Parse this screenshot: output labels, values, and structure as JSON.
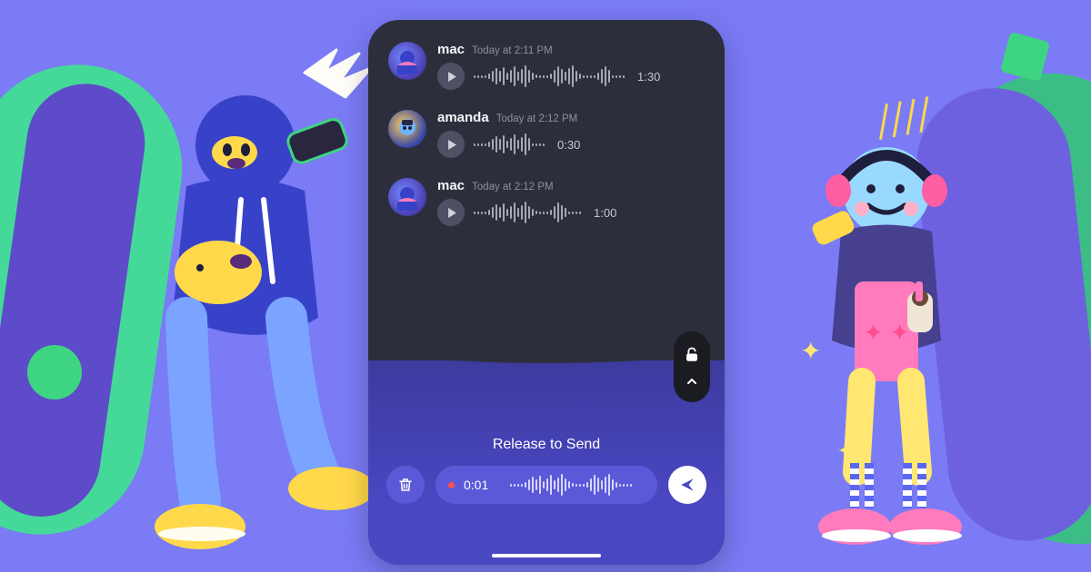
{
  "colors": {
    "bg": "#7a7bf5",
    "phone_bg": "#2c2f3b",
    "panel": "#4a47c2",
    "accent_green": "#3dd581",
    "accent_yellow": "#ffd94a"
  },
  "messages": [
    {
      "username": "mac",
      "avatar": "mac",
      "timestamp": "Today at 2:11 PM",
      "duration": "1:30",
      "wave_len": "long"
    },
    {
      "username": "amanda",
      "avatar": "amanda",
      "timestamp": "Today at 2:12 PM",
      "duration": "0:30",
      "wave_len": "short"
    },
    {
      "username": "mac",
      "avatar": "mac",
      "timestamp": "Today at 2:12 PM",
      "duration": "1:00",
      "wave_len": "med"
    }
  ],
  "recorder": {
    "prompt": "Release to Send",
    "elapsed": "0:01",
    "icons": {
      "trash": "trash-icon",
      "send": "send-icon",
      "lock": "unlock-icon"
    }
  }
}
